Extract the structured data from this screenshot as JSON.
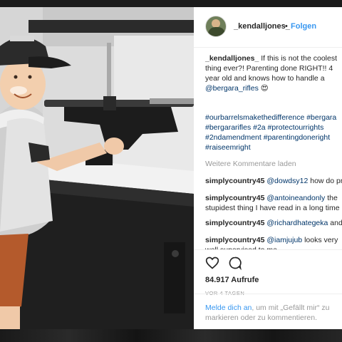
{
  "post": {
    "username": "_kendalljones_",
    "follow_label": "Folgen",
    "separator": "•"
  },
  "caption": {
    "username": "_kendalljones_",
    "text": "If this is not the coolest thing ever?! Parenting done RIGHT!! 4 year old and knows how to handle a",
    "mention": "@bergara_rifles",
    "emoji": "😍",
    "hashtags": "#ourbarrelsmakethedifference #bergara #bergararifles #2a #protectourrights #2ndamendment #parentingdoneright #raiseemright"
  },
  "load_more_label": "Weitere Kommentare laden",
  "comments": [
    {
      "user": "simplycountry45",
      "mention": "@dowdsy12",
      "text": "how do princess"
    },
    {
      "user": "simplycountry45",
      "mention": "@antoineandonly",
      "text": "the stupidest thing I have read in a long time"
    },
    {
      "user": "simplycountry45",
      "mention": "@richardhategeka",
      "text": "and"
    },
    {
      "user": "simplycountry45",
      "mention": "@iamjujub",
      "text": "looks very well supervised to me"
    }
  ],
  "actions": {
    "like_icon": "heart-icon",
    "comment_icon": "comment-bubble-icon",
    "views": "84.917 Aufrufe",
    "age": "VOR 4 TAGEN"
  },
  "login_prompt": {
    "link": "Melde dich an",
    "text": ", um mit „Gefällt mir“ zu markieren oder zu kommentieren."
  },
  "colors": {
    "link_blue": "#3897f0",
    "mention_navy": "#003569",
    "muted": "#999999"
  }
}
